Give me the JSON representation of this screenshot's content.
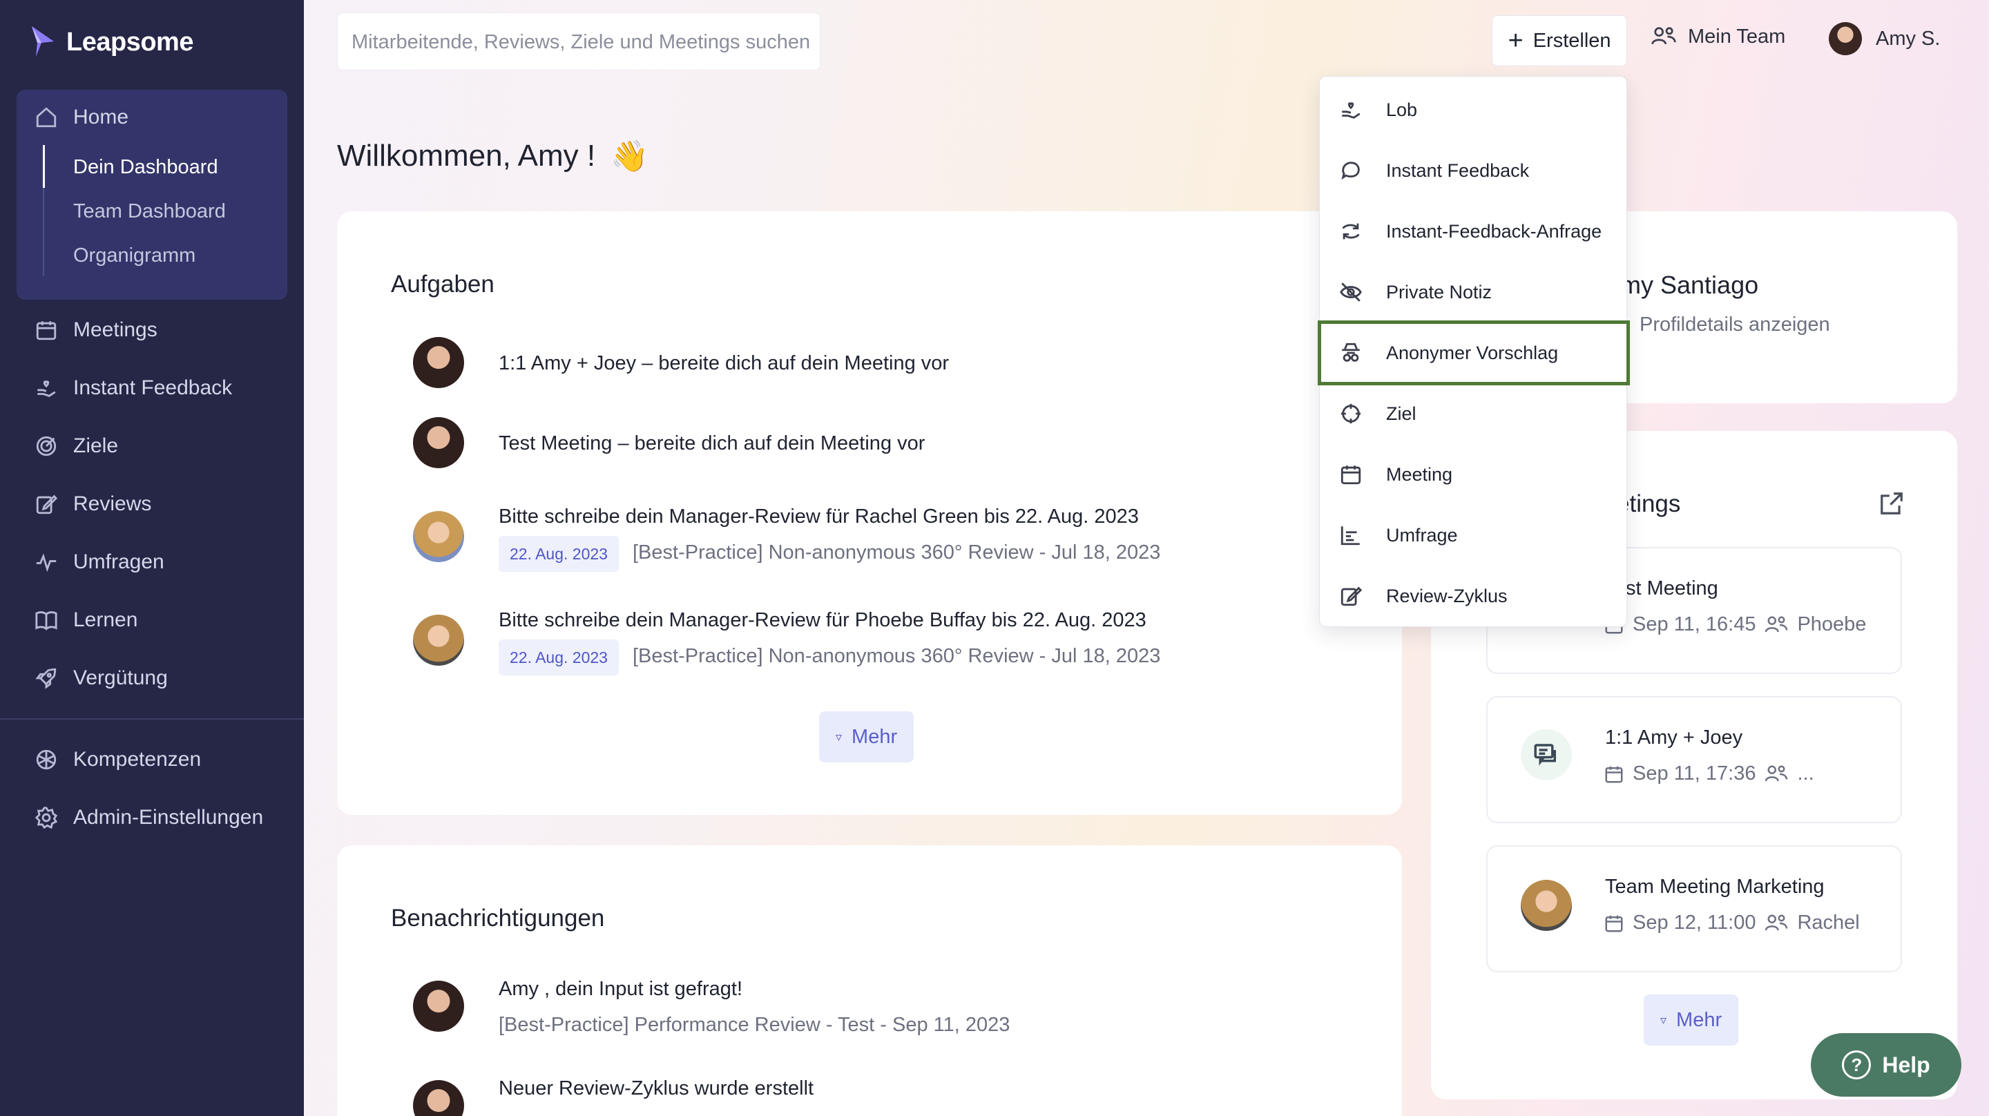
{
  "brand": {
    "name": "Leapsome"
  },
  "sidebar": {
    "home": "Home",
    "home_sub": [
      "Dein Dashboard",
      "Team Dashboard",
      "Organigramm"
    ],
    "items": [
      "Meetings",
      "Instant Feedback",
      "Ziele",
      "Reviews",
      "Umfragen",
      "Lernen",
      "Vergütung"
    ],
    "bottom_items": [
      "Kompetenzen",
      "Admin-Einstellungen"
    ]
  },
  "topbar": {
    "search_placeholder": "Mitarbeitende, Reviews, Ziele und Meetings suchen",
    "create_label": "Erstellen",
    "my_team_label": "Mein Team",
    "user_name": "Amy S."
  },
  "welcome": {
    "text": "Willkommen, Amy !",
    "emoji": "👋"
  },
  "tasks": {
    "title": "Aufgaben",
    "items": [
      {
        "text": "1:1 Amy + Joey – bereite dich auf dein Meeting vor"
      },
      {
        "text": "Test Meeting – bereite dich auf dein Meeting vor"
      },
      {
        "text": "Bitte schreibe dein Manager-Review für Rachel Green bis 22. Aug. 2023",
        "badge": "22. Aug. 2023",
        "sub": "[Best-Practice] Non-anonymous 360° Review - Jul 18, 2023"
      },
      {
        "text": "Bitte schreibe dein Manager-Review für Phoebe Buffay bis 22. Aug. 2023",
        "badge": "22. Aug. 2023",
        "sub": "[Best-Practice] Non-anonymous 360° Review - Jul 18, 2023"
      }
    ],
    "more_label": "Mehr"
  },
  "notifications": {
    "title": "Benachrichtigungen",
    "items": [
      {
        "text": "Amy , dein Input ist gefragt!",
        "sub": "[Best-Practice] Performance Review - Test - Sep 11, 2023"
      },
      {
        "text": "Neuer Review-Zyklus wurde erstellt"
      }
    ]
  },
  "profile": {
    "name_visible": "my Santiago",
    "link": "Profildetails anzeigen"
  },
  "meetings": {
    "title_visible": "etings",
    "items": [
      {
        "title": "st Meeting",
        "time": "Sep 11, 16:45",
        "attendee": "Phoebe"
      },
      {
        "title": "1:1 Amy + Joey",
        "time": "Sep 11, 17:36",
        "attendee": "..."
      },
      {
        "title": "Team Meeting Marketing",
        "time": "Sep 12, 11:00",
        "attendee": "Rachel"
      }
    ],
    "more_label": "Mehr"
  },
  "create_menu": {
    "items": [
      "Lob",
      "Instant Feedback",
      "Instant-Feedback-Anfrage",
      "Private Notiz",
      "Anonymer Vorschlag",
      "Ziel",
      "Meeting",
      "Umfrage",
      "Review-Zyklus"
    ],
    "highlighted": "Anonymer Vorschlag"
  },
  "help": {
    "label": "Help"
  },
  "colors": {
    "sidebar_bg": "#262747",
    "accent": "#5a5fc9",
    "highlight_border": "#4e7a34",
    "help_bg": "#4a7a63"
  }
}
